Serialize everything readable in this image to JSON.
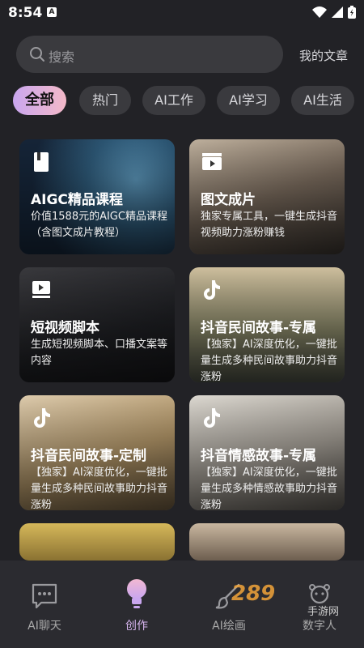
{
  "status": {
    "time": "8:54",
    "note": "A"
  },
  "search": {
    "placeholder": "搜索"
  },
  "header": {
    "my_articles": "我的文章"
  },
  "tabs": [
    {
      "label": "全部",
      "active": true
    },
    {
      "label": "热门"
    },
    {
      "label": "AI工作"
    },
    {
      "label": "AI学习"
    },
    {
      "label": "AI生活"
    }
  ],
  "cards": [
    {
      "icon": "book-icon",
      "title": "AIGC精品课程",
      "desc": "价值1588元的AIGC精品课程（含图文成片教程）"
    },
    {
      "icon": "clapperboard-icon",
      "title": "图文成片",
      "desc": "独家专属工具，一键生成抖音视频助力涨粉赚钱"
    },
    {
      "icon": "video-script-icon",
      "title": "短视频脚本",
      "desc": "生成短视频脚本、口播文案等内容"
    },
    {
      "icon": "tiktok-icon",
      "title": "抖音民间故事-专属",
      "desc": "【独家】AI深度优化，一键批量生成多种民间故事助力抖音涨粉"
    },
    {
      "icon": "tiktok-icon",
      "title": "抖音民间故事-定制",
      "desc": "【独家】AI深度优化，一键批量生成多种民间故事助力抖音涨粉"
    },
    {
      "icon": "tiktok-icon",
      "title": "抖音情感故事-专属",
      "desc": "【独家】AI深度优化，一键批量生成多种情感故事助力抖音涨粉"
    }
  ],
  "nav": [
    {
      "label": "AI聊天",
      "icon": "chat-icon",
      "active": false
    },
    {
      "label": "创作",
      "icon": "bulb-icon",
      "active": true
    },
    {
      "label": "AI绘画",
      "icon": "brush-icon",
      "active": false
    },
    {
      "label": "数字人",
      "icon": "digital-human-icon",
      "active": false
    }
  ],
  "watermark": {
    "text": "289",
    "sub": "手游网"
  },
  "colors": {
    "accent": "#d6b4ee",
    "background": "#222226"
  }
}
